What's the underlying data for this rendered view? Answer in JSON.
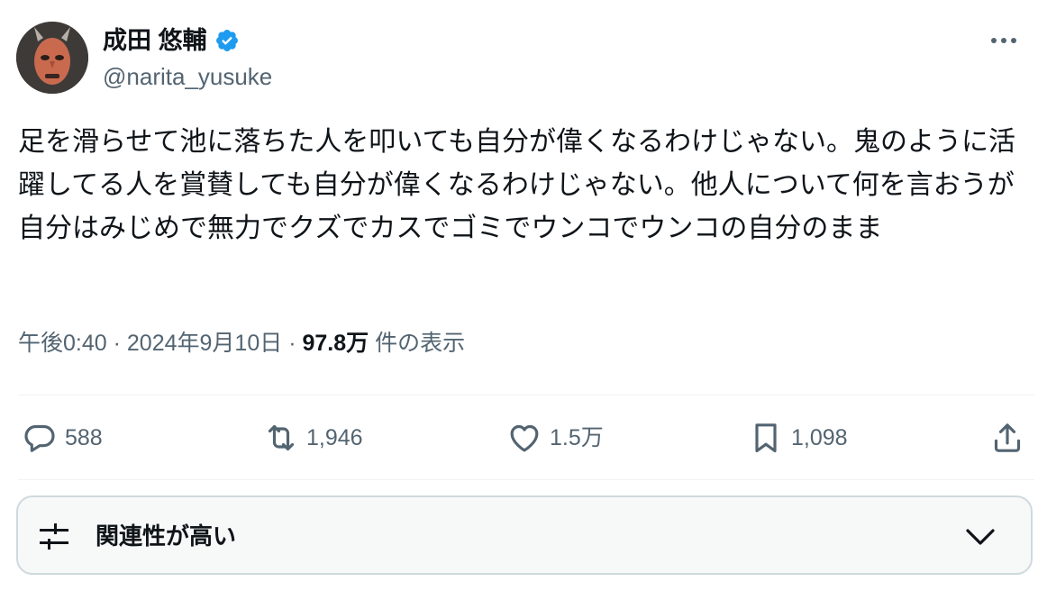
{
  "author": {
    "display_name": "成田 悠輔",
    "handle": "@narita_yusuke",
    "verified": true,
    "avatar_icon": "face-mask-avatar"
  },
  "tweet": {
    "text": "足を滑らせて池に落ちた人を叩いても自分が偉くなるわけじゃない。鬼のように活躍してる人を賞賛しても自分が偉くなるわけじゃない。他人について何を言おうが自分はみじめで無力でクズでカスでゴミでウンコでウンコの自分のまま",
    "time": "午後0:40",
    "separator": "·",
    "date": "2024年9月10日",
    "views_count": "97.8万",
    "views_label": "件の表示"
  },
  "actions": {
    "replies": "588",
    "retweets": "1,946",
    "likes": "1.5万",
    "bookmarks": "1,098"
  },
  "reply_sort": {
    "label": "関連性が高い",
    "icon": "sliders-icon"
  },
  "colors": {
    "text": "#0f1419",
    "muted": "#536471",
    "verified": "#1d9bf0",
    "border": "#cfd9de"
  }
}
